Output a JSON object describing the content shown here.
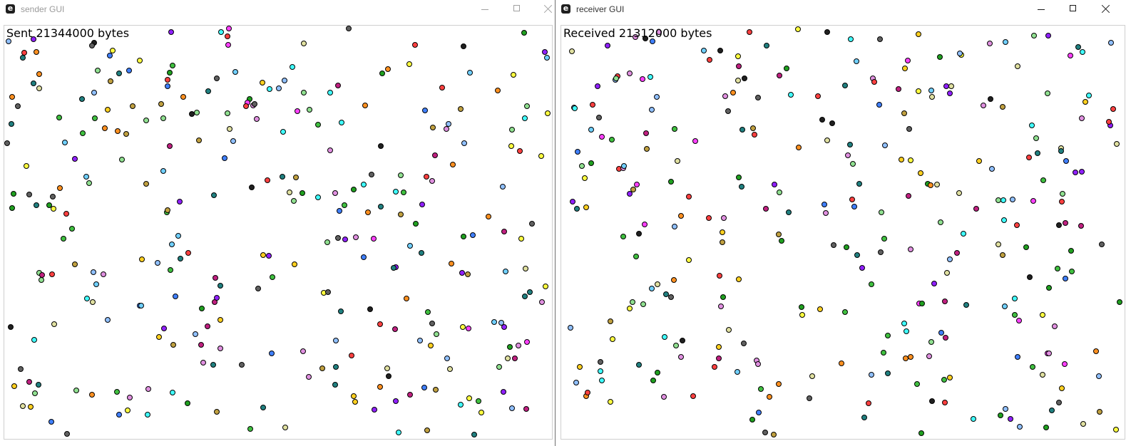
{
  "windows": {
    "sender": {
      "title": "sender GUI",
      "icon_letter": "e",
      "counter": "Sent 21344000 bytes"
    },
    "receiver": {
      "title": "receiver GUI",
      "icon_letter": "e",
      "counter": "Received 21312000 bytes"
    }
  },
  "icons": {
    "app": "electron-app-icon",
    "minimize": "minimize-icon",
    "maximize": "maximize-icon",
    "close": "close-icon"
  },
  "dot_palette": [
    "#ff4040",
    "#40c040",
    "#4080ff",
    "#ffff40",
    "#ff40ff",
    "#40ffff",
    "#ff9020",
    "#9020ff",
    "#202020",
    "#90e090",
    "#e090e0",
    "#90c0ff",
    "#c0a040",
    "#208080",
    "#e0e0a0",
    "#606060",
    "#20a020",
    "#c02080",
    "#ffd020",
    "#70d0ff"
  ]
}
